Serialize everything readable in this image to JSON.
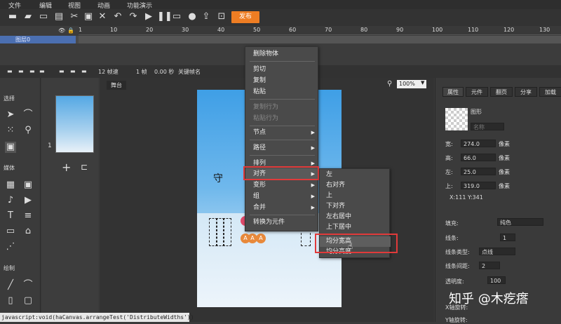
{
  "menu": [
    "文件",
    "编辑",
    "视图",
    "动画",
    "功能演示"
  ],
  "toolbar": {
    "publish_label": "发布"
  },
  "timeline": {
    "ruler_ticks": [
      "1",
      "10",
      "20",
      "30",
      "40",
      "50",
      "60",
      "70",
      "80",
      "90",
      "100",
      "110",
      "120",
      "130"
    ],
    "layer_name": "图层0",
    "fps": "12 帧速",
    "frame": "1 帧",
    "time": "0.00 秒",
    "keyframe_label": "关键帧名"
  },
  "left_tools": {
    "select_title": "选择",
    "media_title": "媒体",
    "draw_title": "绘制"
  },
  "thumbnail": {
    "index": "1"
  },
  "stage": {
    "tab": "舞台",
    "zoom": "100%",
    "text": "守"
  },
  "right_panel": {
    "tabs": [
      "属性",
      "元件",
      "翻页",
      "分享",
      "加载"
    ],
    "shape_label": "图形",
    "name_placeholder": "名称",
    "width_label": "宽:",
    "width_value": "274.0",
    "height_label": "高:",
    "height_value": "66.0",
    "left_label": "左:",
    "left_value": "25.0",
    "top_label": "上:",
    "top_value": "319.0",
    "unit": "像素",
    "coords": "X:111  Y:341",
    "fill_label": "填充:",
    "fill_value": "纯色",
    "line_label": "线条:",
    "line_width": "1",
    "line_type_label": "线条类型:",
    "line_type_value": "点线",
    "line_gap_label": "线条间距:",
    "line_gap_value": "2",
    "opacity_label": "透明度:",
    "opacity_value": "100",
    "rotate_label": "X轴旋转:",
    "y_rotate_label": "Y轴旋转:"
  },
  "context_menu": {
    "items": [
      "删除物体",
      "剪切",
      "复制",
      "粘贴",
      "复制行为",
      "粘贴行为",
      "节点",
      "路径",
      "排列",
      "对齐",
      "变形",
      "组",
      "合并",
      "转换为元件"
    ],
    "submenu": [
      "左",
      "右对齐",
      "上",
      "下对齐",
      "左右居中",
      "上下居中",
      "均分宽高",
      "均分高度"
    ]
  },
  "status_text": "javascript:void(haCanvas.arrangeTest('DistributeWidths'))",
  "watermark": "知乎 @木疙瘩"
}
